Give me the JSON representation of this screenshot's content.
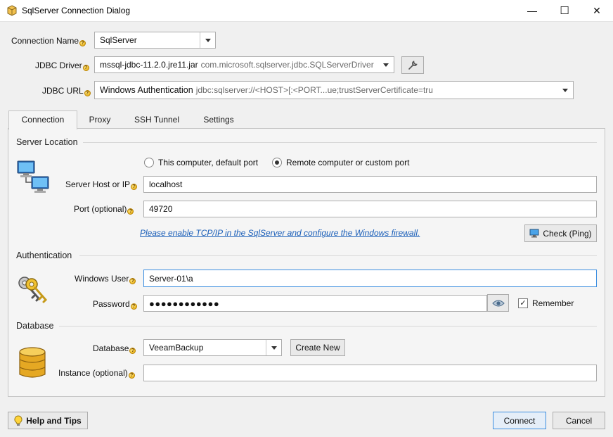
{
  "window": {
    "title": "SqlServer Connection Dialog",
    "minimize_glyph": "—",
    "maximize_glyph": "☐",
    "close_glyph": "✕"
  },
  "connection_name": {
    "label": "Connection Name",
    "value": "SqlServer"
  },
  "jdbc_driver": {
    "label": "JDBC Driver",
    "value": "mssql-jdbc-11.2.0.jre11.jar",
    "class_name": "com.microsoft.sqlserver.jdbc.SQLServerDriver"
  },
  "jdbc_url": {
    "label": "JDBC URL",
    "value": "Windows Authentication",
    "template": "jdbc:sqlserver://<HOST>[:<PORT...ue;trustServerCertificate=tru"
  },
  "tabs": [
    {
      "label": "Connection",
      "active": true
    },
    {
      "label": "Proxy",
      "active": false
    },
    {
      "label": "SSH Tunnel",
      "active": false
    },
    {
      "label": "Settings",
      "active": false
    }
  ],
  "server_location": {
    "heading": "Server Location",
    "radio_default": "This computer, default port",
    "radio_remote": "Remote computer or custom port",
    "selected": "remote",
    "host_label": "Server Host or IP",
    "host_value": "localhost",
    "port_label": "Port (optional)",
    "port_value": "49720",
    "tcp_link": "Please enable TCP/IP in the SqlServer and configure the Windows firewall.",
    "check_button": "Check (Ping)"
  },
  "authentication": {
    "heading": "Authentication",
    "user_label": "Windows User",
    "user_value": "Server-01\\a",
    "password_label": "Password",
    "password_value": "●●●●●●●●●●●●",
    "remember_label": "Remember",
    "remember_checked": true
  },
  "database": {
    "heading": "Database",
    "db_label": "Database",
    "db_value": "VeeamBackup",
    "create_button": "Create New",
    "instance_label": "Instance (optional)",
    "instance_value": ""
  },
  "footer": {
    "help_button": "Help and Tips",
    "connect_button": "Connect",
    "cancel_button": "Cancel"
  },
  "colors": {
    "link": "#1a5eb8",
    "focus": "#3c8ee0"
  },
  "help_glyph": "?",
  "check_glyph": "✓"
}
